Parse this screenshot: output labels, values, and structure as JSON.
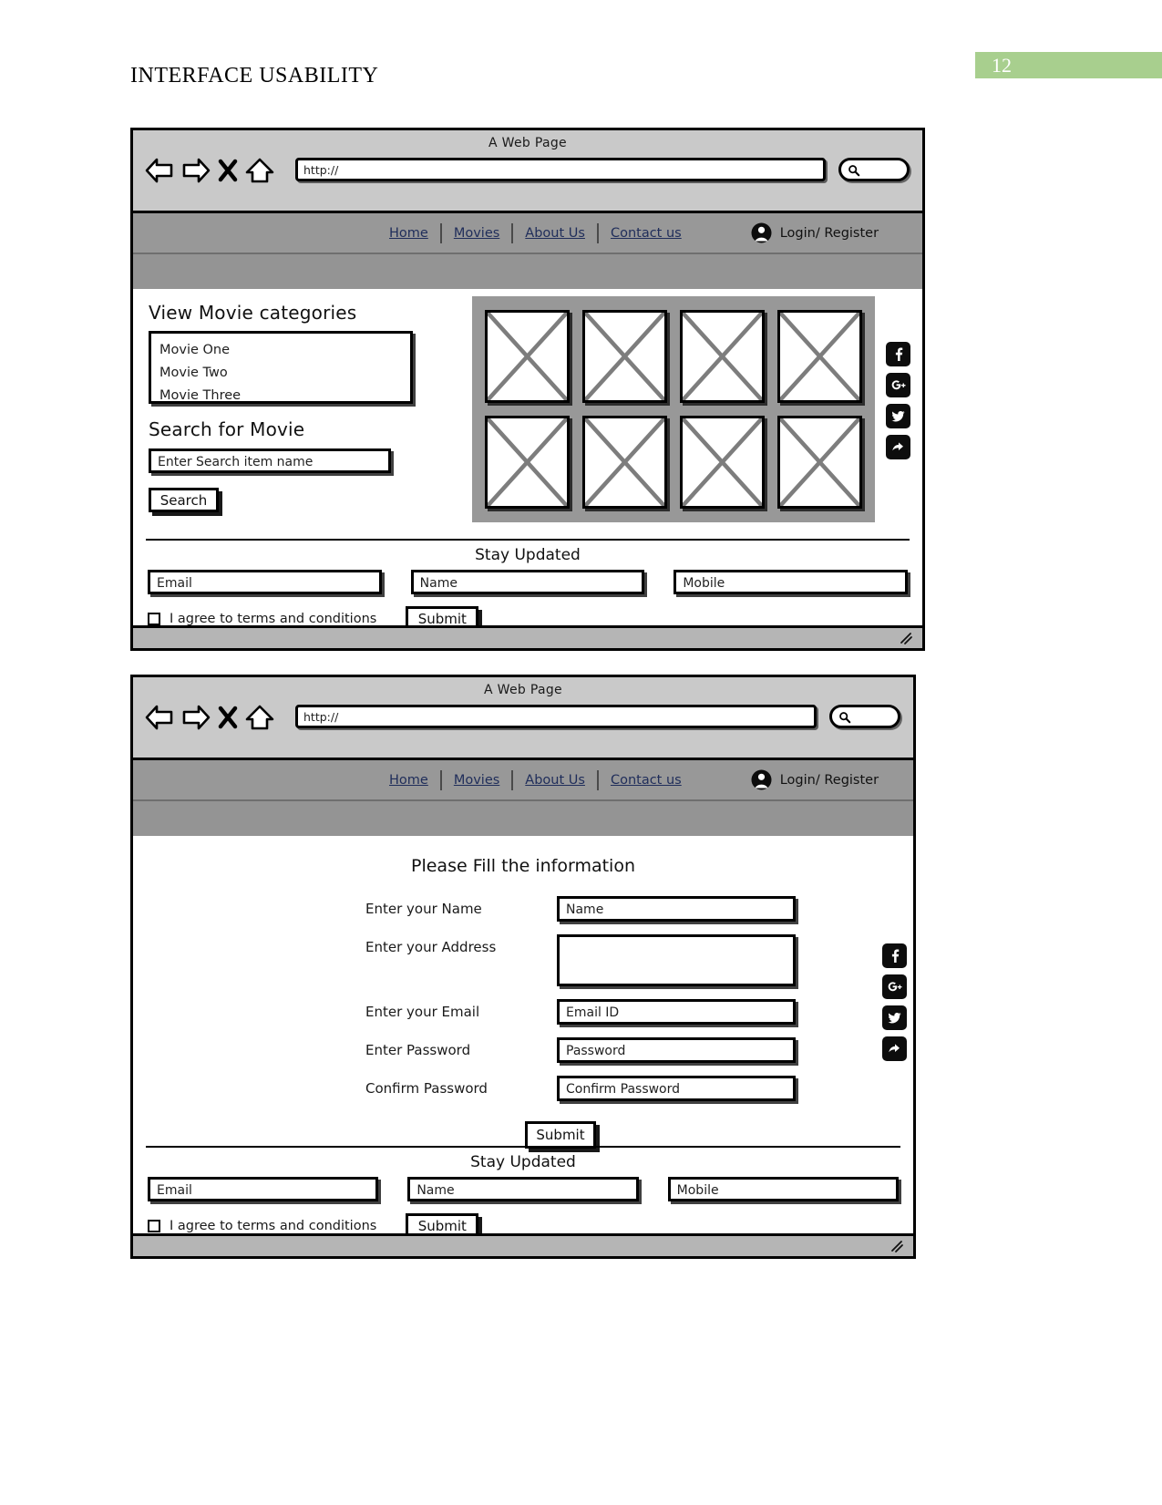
{
  "document": {
    "title": "INTERFACE USABILITY",
    "page_number": "12",
    "badge_color": "#a8cf8e"
  },
  "browser_chrome": {
    "window_title": "A Web Page",
    "url_value": "http://",
    "back_icon": "back-arrow-icon",
    "forward_icon": "forward-arrow-icon",
    "stop_icon": "close-x-icon",
    "home_icon": "home-icon",
    "search_icon": "magnifier-icon"
  },
  "site_nav": {
    "links": [
      {
        "label": "Home"
      },
      {
        "label": "Movies"
      },
      {
        "label": "About Us"
      },
      {
        "label": "Contact us"
      }
    ],
    "account": {
      "icon": "user-avatar-icon",
      "label": "Login/ Register"
    }
  },
  "social": {
    "items": [
      {
        "name": "facebook-icon"
      },
      {
        "name": "google-plus-icon"
      },
      {
        "name": "twitter-icon"
      },
      {
        "name": "share-icon"
      }
    ]
  },
  "screen_one": {
    "categories_heading": "View Movie categories",
    "categories": [
      {
        "label": "Movie One"
      },
      {
        "label": "Movie Two"
      },
      {
        "label": "Movie Three"
      }
    ],
    "search_heading": "Search for Movie",
    "search_placeholder": "Enter Search item name",
    "search_button": "Search",
    "image_grid": {
      "count": 8,
      "rows": 2,
      "columns": 4,
      "placeholder_icon": "image-placeholder-icon"
    }
  },
  "screen_two": {
    "form_title": "Please Fill the information",
    "fields": [
      {
        "label": "Enter your Name",
        "placeholder": "Name"
      },
      {
        "label": "Enter your Address",
        "placeholder": ""
      },
      {
        "label": "Enter your Email",
        "placeholder": "Email ID"
      },
      {
        "label": "Enter Password",
        "placeholder": "Password"
      },
      {
        "label": "Confirm Password",
        "placeholder": "Confirm Password"
      }
    ],
    "submit_button": "Submit"
  },
  "stay_updated": {
    "title": "Stay Updated",
    "email_placeholder": "Email",
    "name_placeholder": "Name",
    "mobile_placeholder": "Mobile",
    "agree_label": "I agree to terms and conditions",
    "submit_button": "Submit"
  },
  "status_bar": {
    "resize_icon": "resize-grip-icon"
  }
}
